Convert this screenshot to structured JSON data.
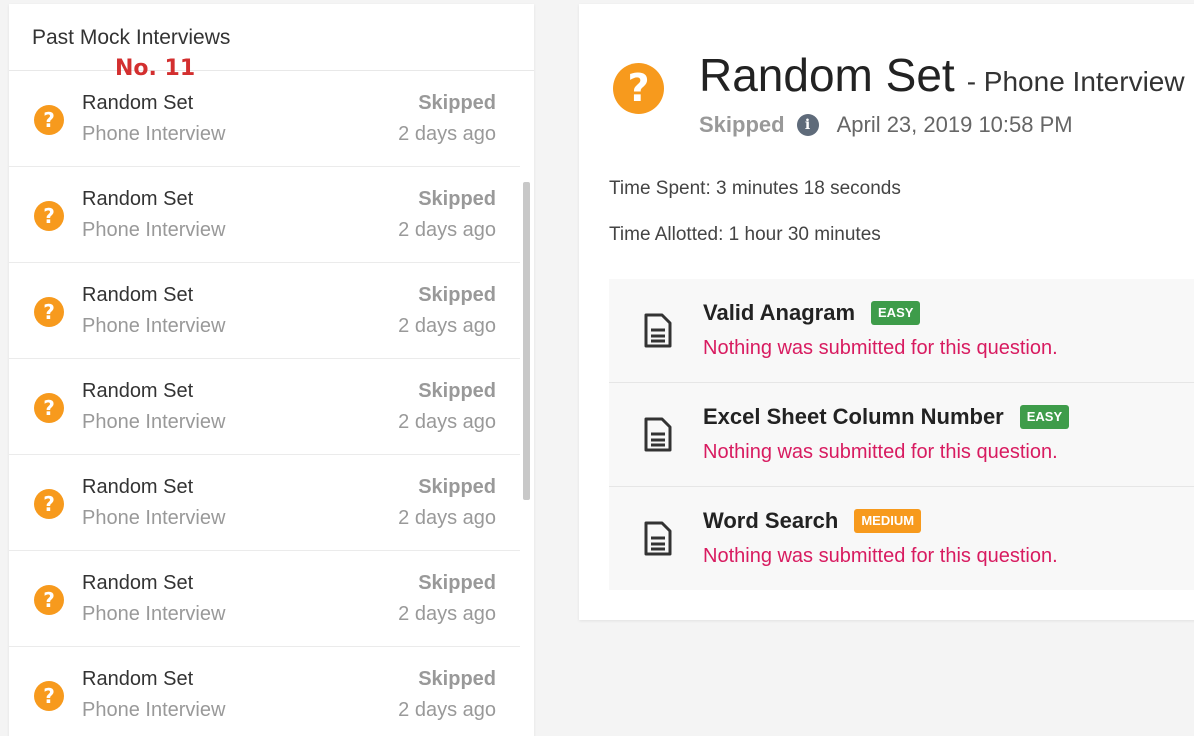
{
  "sidebar": {
    "title": "Past Mock Interviews",
    "annotation": "No. 11",
    "items": [
      {
        "title": "Random Set",
        "subtitle": "Phone Interview",
        "status": "Skipped",
        "time": "2 days ago"
      },
      {
        "title": "Random Set",
        "subtitle": "Phone Interview",
        "status": "Skipped",
        "time": "2 days ago"
      },
      {
        "title": "Random Set",
        "subtitle": "Phone Interview",
        "status": "Skipped",
        "time": "2 days ago"
      },
      {
        "title": "Random Set",
        "subtitle": "Phone Interview",
        "status": "Skipped",
        "time": "2 days ago"
      },
      {
        "title": "Random Set",
        "subtitle": "Phone Interview",
        "status": "Skipped",
        "time": "2 days ago"
      },
      {
        "title": "Random Set",
        "subtitle": "Phone Interview",
        "status": "Skipped",
        "time": "2 days ago"
      },
      {
        "title": "Random Set",
        "subtitle": "Phone Interview",
        "status": "Skipped",
        "time": "2 days ago"
      }
    ]
  },
  "detail": {
    "title": "Random Set",
    "subtitle": "- Phone Interview",
    "status": "Skipped",
    "date": "April 23, 2019 10:58 PM",
    "time_spent": "Time Spent: 3 minutes 18 seconds",
    "time_allotted": "Time Allotted: 1 hour 30 minutes",
    "questions": [
      {
        "title": "Valid Anagram",
        "difficulty": "EASY",
        "note": "Nothing was submitted for this question."
      },
      {
        "title": "Excel Sheet Column Number",
        "difficulty": "EASY",
        "note": "Nothing was submitted for this question."
      },
      {
        "title": "Word Search",
        "difficulty": "MEDIUM",
        "note": "Nothing was submitted for this question."
      }
    ]
  },
  "icons": {
    "question": "?",
    "info": "i"
  },
  "colors": {
    "accent_orange": "#f79a1d",
    "easy_green": "#3e9c4a",
    "note_pink": "#d81b60",
    "annotation_red": "#d32f2f"
  }
}
